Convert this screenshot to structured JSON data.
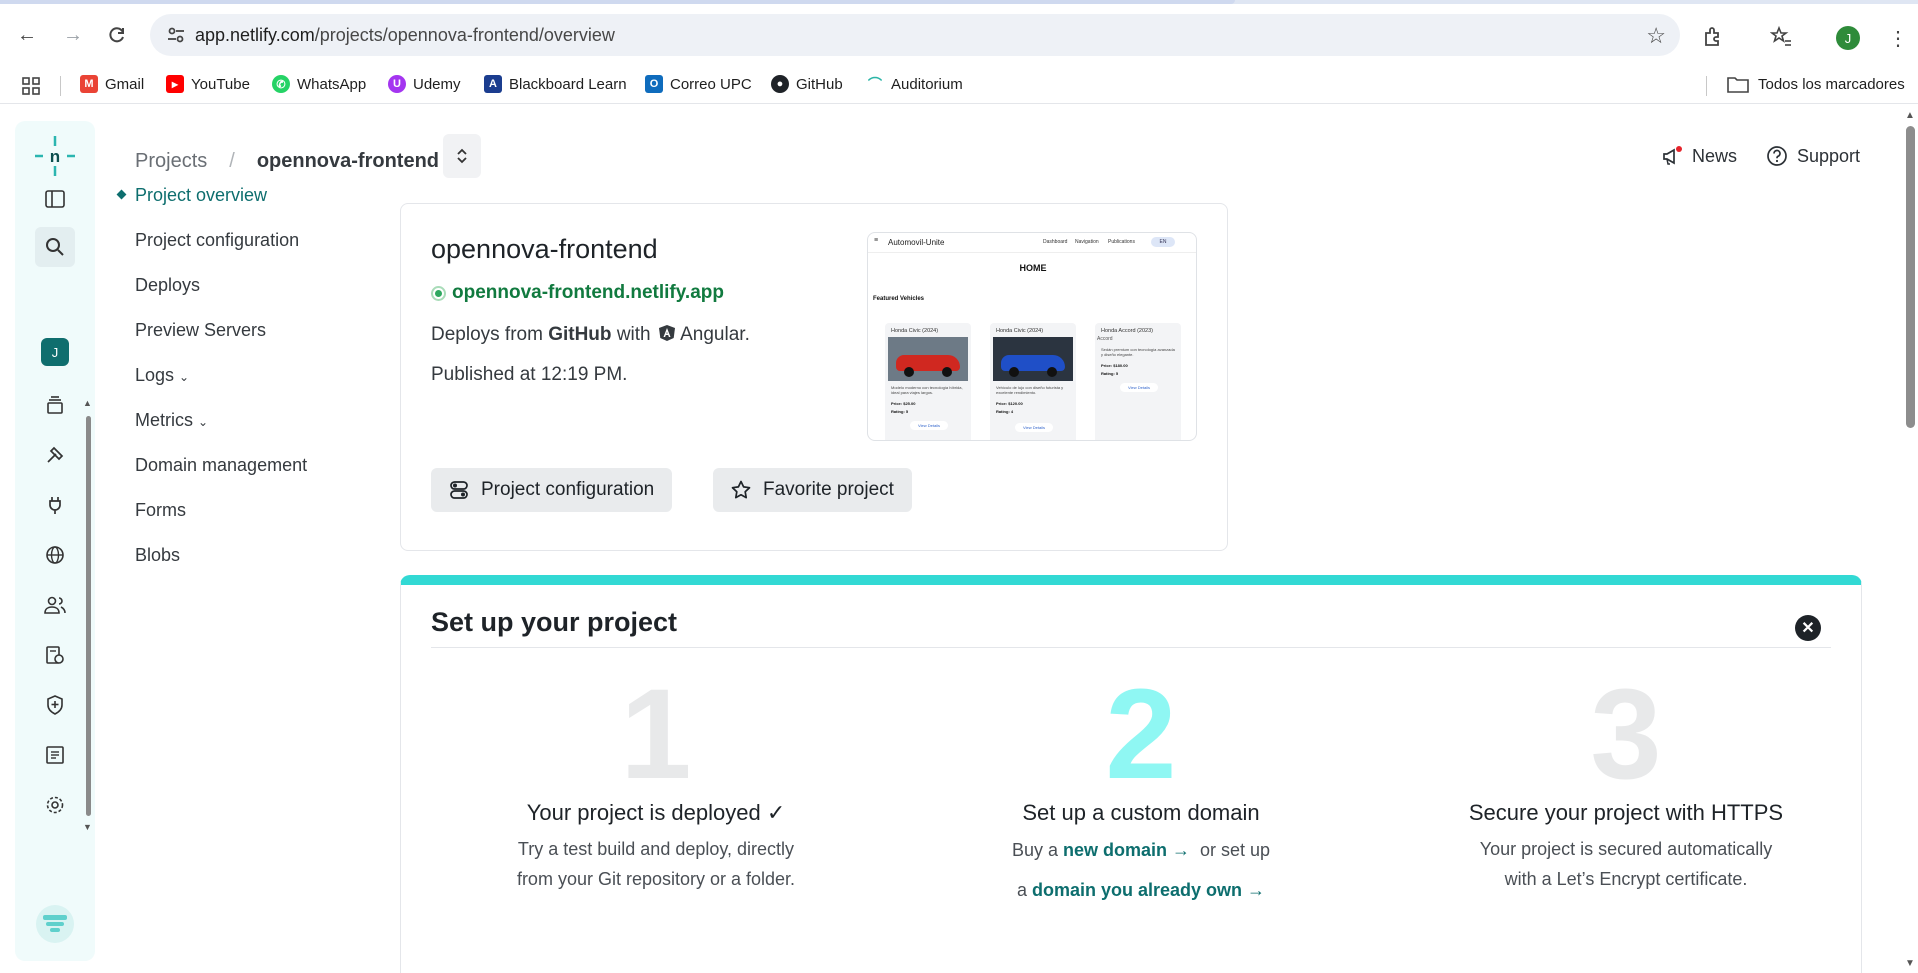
{
  "browser": {
    "url_host": "app.netlify.com",
    "url_path": "/projects/opennova-frontend/overview",
    "profile_initial": "J",
    "bookmarks": [
      {
        "label": "Gmail",
        "color": "#ea4335",
        "glyph": "M"
      },
      {
        "label": "YouTube",
        "color": "#ff0000",
        "glyph": "▶"
      },
      {
        "label": "WhatsApp",
        "color": "#25d366",
        "glyph": "✆"
      },
      {
        "label": "Udemy",
        "color": "#a435f0",
        "glyph": "U"
      },
      {
        "label": "Blackboard Learn",
        "color": "#1b3d8f",
        "glyph": "A"
      },
      {
        "label": "Correo UPC",
        "color": "#0f6cbd",
        "glyph": "O"
      },
      {
        "label": "GitHub",
        "color": "#1f2328",
        "glyph": "●"
      },
      {
        "label": "Auditorium",
        "color": "#2bb5a7",
        "glyph": "⌒"
      }
    ],
    "all_bookmarks": "Todos los marcadores"
  },
  "header": {
    "crumb_projects": "Projects",
    "crumb_separator": "/",
    "crumb_current": "opennova-frontend",
    "news": "News",
    "support": "Support"
  },
  "rail": {
    "avatar_initial": "J"
  },
  "subnav": [
    {
      "label": "Project overview",
      "active": true,
      "caret": false
    },
    {
      "label": "Project configuration",
      "active": false,
      "caret": false
    },
    {
      "label": "Deploys",
      "active": false,
      "caret": false
    },
    {
      "label": "Preview Servers",
      "active": false,
      "caret": false
    },
    {
      "label": "Logs",
      "active": false,
      "caret": true
    },
    {
      "label": "Metrics",
      "active": false,
      "caret": true
    },
    {
      "label": "Domain management",
      "active": false,
      "caret": false
    },
    {
      "label": "Forms",
      "active": false,
      "caret": false
    },
    {
      "label": "Blobs",
      "active": false,
      "caret": false
    }
  ],
  "project": {
    "name": "opennova-frontend",
    "site_url": "opennova-frontend.netlify.app",
    "deploys_prefix": "Deploys from",
    "deploys_source": "GitHub",
    "deploys_with": "with",
    "framework": "Angular.",
    "published": "Published at 12:19 PM.",
    "btn_config": "Project configuration",
    "btn_favorite": "Favorite project",
    "preview": {
      "brand": "Automovil-Unite",
      "nav": [
        "Dashboard",
        "Navigation",
        "Publications"
      ],
      "lang": "EN",
      "heading": "HOME",
      "section": "Featured Vehicles",
      "cards": [
        {
          "title": "Honda Civic (2024)",
          "car_color": "#d02820",
          "desc": "Modelo moderno con tecnología híbrida, ideal para viajes largos.",
          "price": "Price: $25.00",
          "rating": "Rating: 5",
          "cta": "View Details"
        },
        {
          "title": "Honda Civic (2024)",
          "car_color": "#1f4fc7",
          "desc": "Vehículo de lujo con diseño futurista y excelente rendimiento.",
          "price": "Price: $120.00",
          "rating": "Rating: 4",
          "cta": "View Details"
        },
        {
          "title": "Honda Accord (2023)",
          "car_color": "",
          "alt": "Accord",
          "desc": "Sedán premium con tecnología avanzada y diseño elegante.",
          "price": "Price: $180.00",
          "rating": "Rating: 5",
          "cta": "View Details"
        }
      ]
    }
  },
  "setup": {
    "title": "Set up your project",
    "steps": [
      {
        "num": "1",
        "heading": "Your project is deployed ✓",
        "line1": "Try a test build and deploy, directly",
        "line2": "from your Git repository or a folder."
      },
      {
        "num": "2",
        "heading": "Set up a custom domain",
        "pre1": "Buy a",
        "link1": "new domain →",
        "mid": "or set up",
        "pre2": "a",
        "link2": "domain you already own →"
      },
      {
        "num": "3",
        "heading": "Secure your project with HTTPS",
        "line1": "Your project is secured automatically",
        "line2": "with a Let’s Encrypt certificate."
      }
    ]
  },
  "colors": {
    "accent": "#0d6e6e",
    "live": "#30a860",
    "setup_bar": "#32d9d4",
    "step_highlight": "#8ff7f3"
  }
}
